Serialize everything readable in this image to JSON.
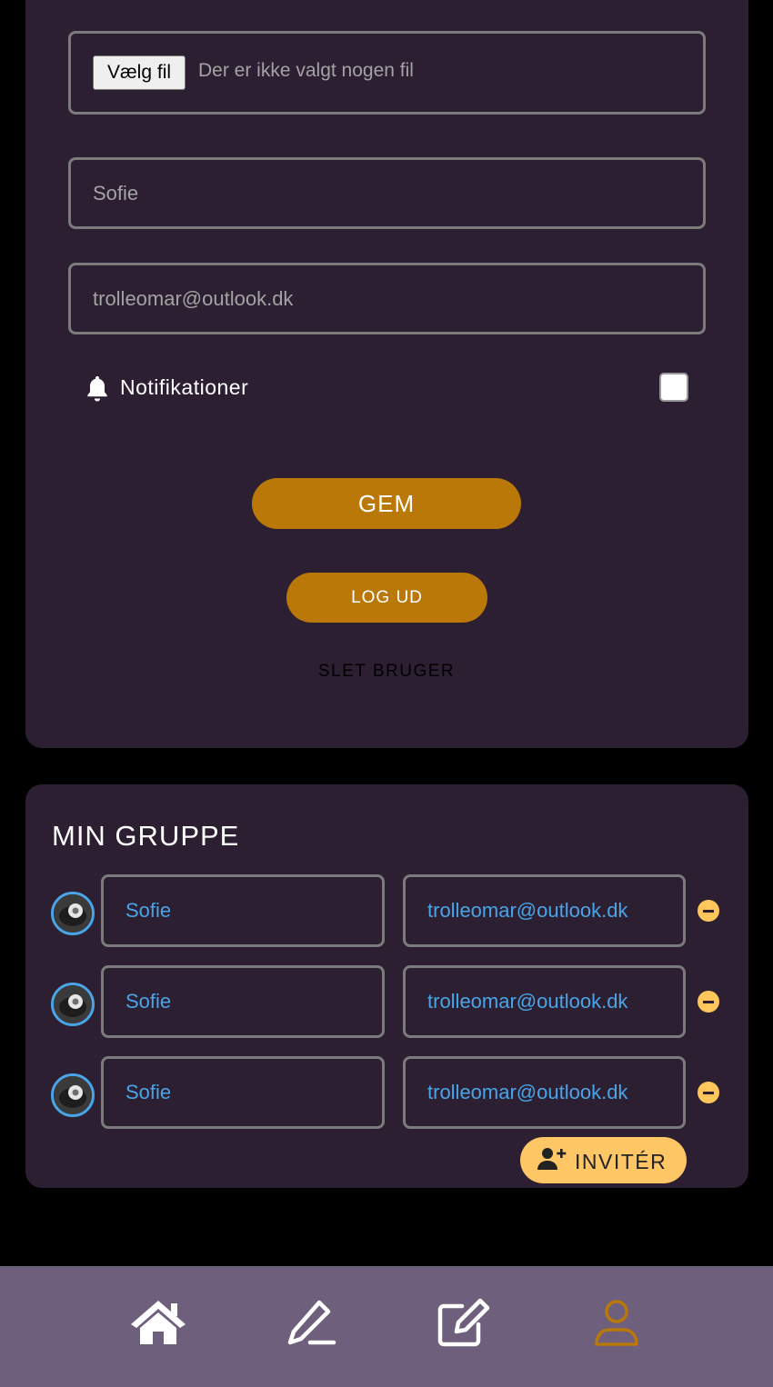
{
  "profile": {
    "file_button": "Vælg fil",
    "file_status": "Der er ikke valgt nogen fil",
    "name_value": "Sofie",
    "email_value": "trolleomar@outlook.dk",
    "notifications_label": "Notifikationer",
    "notifications_checked": false,
    "save_label": "GEM",
    "logout_label": "LOG UD",
    "delete_label": "SLET BRUGER"
  },
  "group": {
    "title": "MIN GRUPPE",
    "members": [
      {
        "name": "Sofie",
        "email": "trolleomar@outlook.dk"
      },
      {
        "name": "Sofie",
        "email": "trolleomar@outlook.dk"
      },
      {
        "name": "Sofie",
        "email": "trolleomar@outlook.dk"
      }
    ],
    "invite_label": "INVITÉR"
  },
  "nav": {
    "items": [
      {
        "icon": "home-icon",
        "active": false
      },
      {
        "icon": "pen-icon",
        "active": false
      },
      {
        "icon": "edit-square-icon",
        "active": false
      },
      {
        "icon": "user-icon",
        "active": true
      }
    ]
  },
  "colors": {
    "accent": "#ba7809",
    "invite": "#ffc665",
    "card_bg": "#2c1f31",
    "nav_bg": "#6e5f7d",
    "member_text": "#4aa4e8"
  }
}
